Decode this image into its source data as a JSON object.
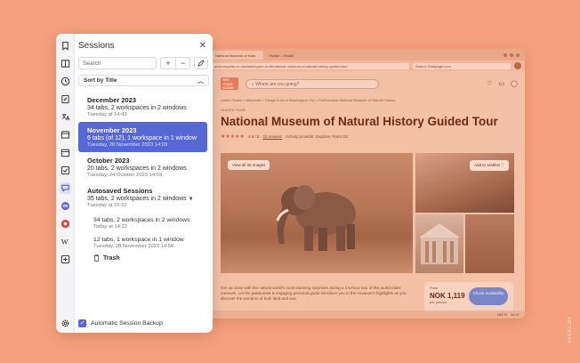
{
  "browser": {
    "tabs": [
      {
        "label": "National Museum of Natu"
      },
      {
        "label": "Vivaldi – Vivaldi"
      }
    ],
    "url": "getyourguide.co.uk/washington-dc-l6/national-museum-of-natural-history-guided-tour",
    "websearch_placeholder": "Search Startpage.com",
    "site": {
      "logo_text": "GET YOUR GUIDE",
      "search_placeholder": "Where are you going?",
      "breadcrumbs": "United States  >  Maryland  >  Things to do in Washington, DC  >  Smithsonian National Museum of Natural History",
      "guided_label": "GUIDED TOUR",
      "title": "National Museum of Natural History Guided Tour",
      "stars": "★★★★★",
      "rating": "4.9 / 5",
      "reviews": "22 reviews",
      "provider": "Activity provider: Explorer Tours DC",
      "view_images": "View all 25 images",
      "add_wishlist": "Add to wishlist ♡",
      "description": "Get up close with the natural world's most stunning surprises during a 2.5-hour tour of this world-class museum. Let the passionate & engaging personal guide introduce you to the museum's highlights as you discover the wonders of both land and sea.",
      "price_from": "From",
      "price_value": "NOK 1,119",
      "price_per": "per person",
      "check_button": "Check availability",
      "zoom": "100 %",
      "clock": "14:47"
    }
  },
  "panel": {
    "title": "Sessions",
    "search_placeholder": "Search",
    "sort_label": "Sort by Title",
    "sessions": [
      {
        "title": "December 2023",
        "summary": "34 tabs, 2 workspaces in 2 windows",
        "date": "Tuesday at 14:43"
      },
      {
        "title": "November 2023",
        "summary": "6 tabs (of 12), 1 workspace in 1 window",
        "date": "Tuesday, 28 November 2023 14:03"
      },
      {
        "title": "October 2023",
        "summary": "20 tabs, 2 workspaces in 2 windows",
        "date": "Tuesday, 24 October 2023 14:03"
      },
      {
        "title": "Autosaved Sessions",
        "summary": "35 tabs, 2 workspaces in 2 windows",
        "date": "Tuesday at 15:22"
      }
    ],
    "autosaved": [
      {
        "summary": "34 tabs, 2 workspaces in 2 windows",
        "date": "Today at 14:22"
      },
      {
        "summary": "12 tabs, 1 workspace in 1 window",
        "date": "Tuesday, 28 November 2023 14:58"
      }
    ],
    "trash_label": "Trash",
    "backup_label": "Automatic Session Backup",
    "backup_checked": true
  },
  "watermark": "VIVALDI",
  "colors": {
    "background": "#f5a17e",
    "selection": "#5668d6"
  }
}
